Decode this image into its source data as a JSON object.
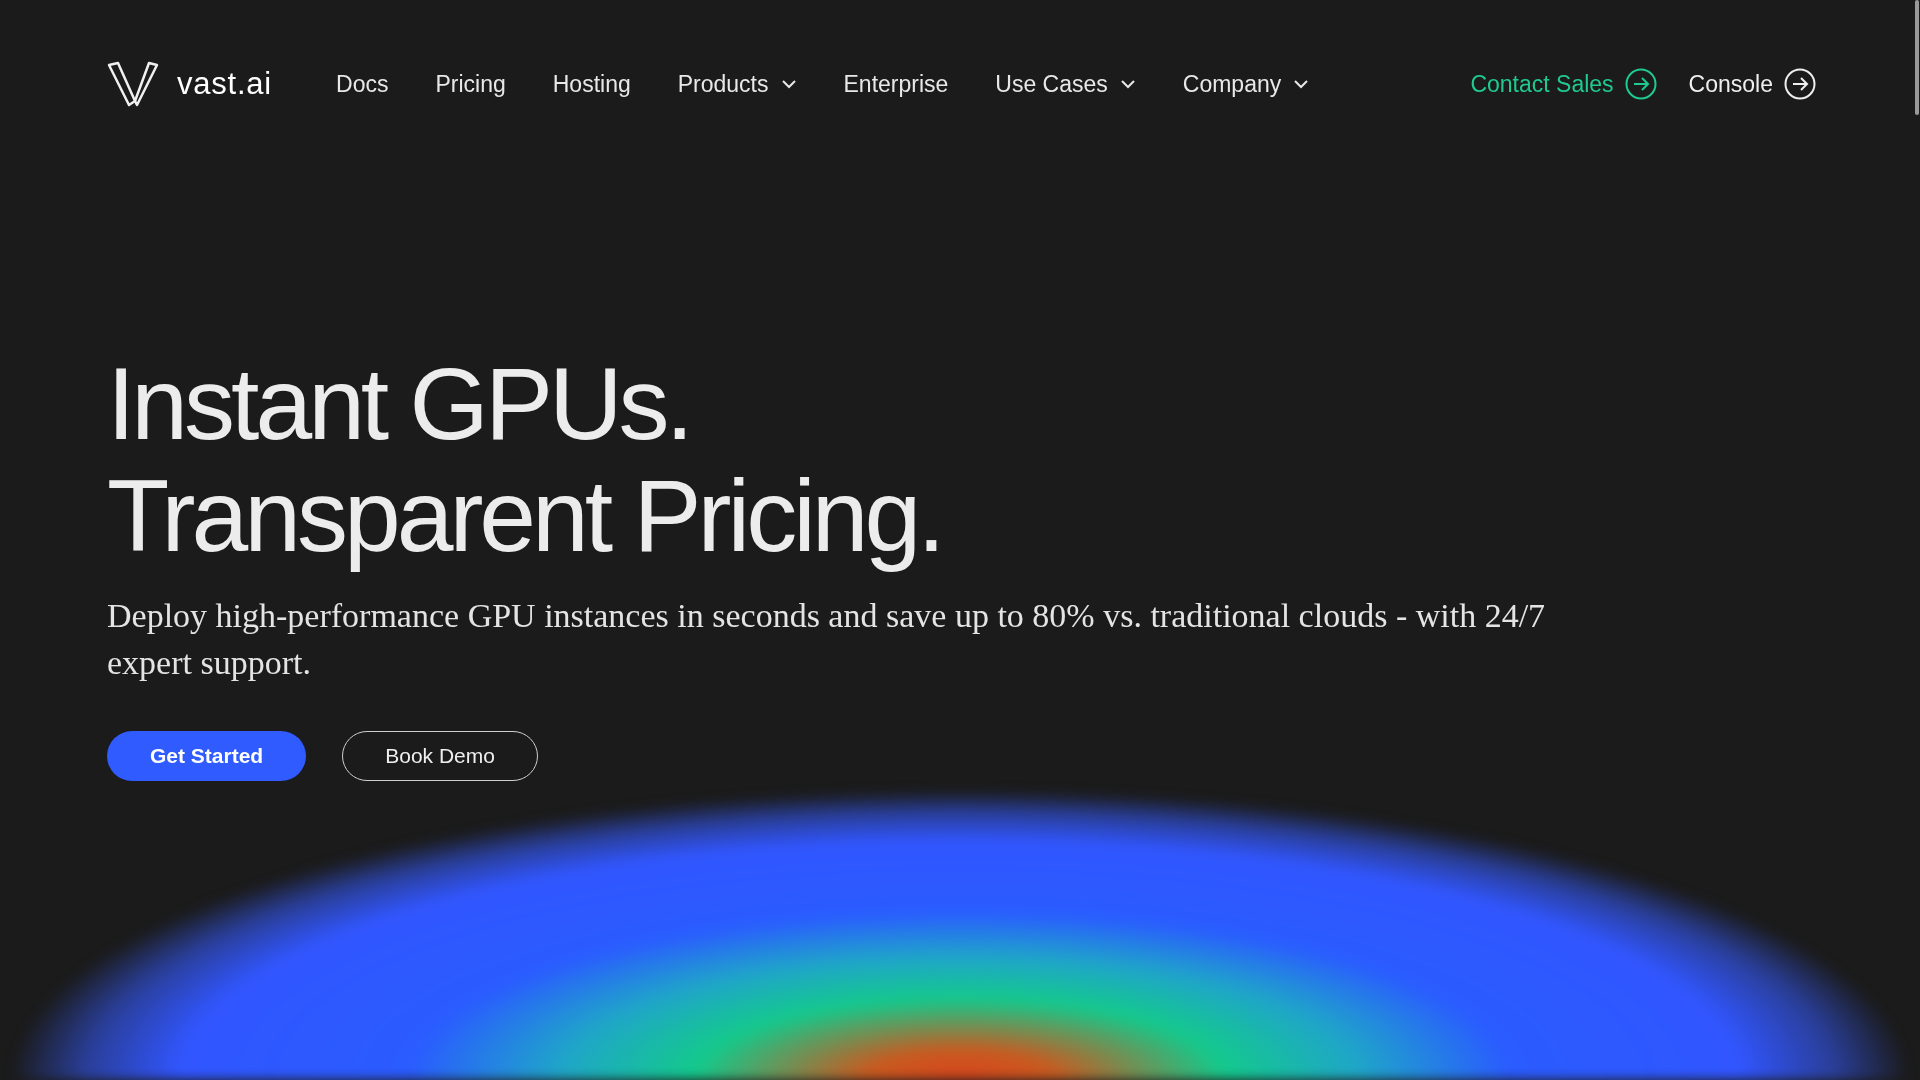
{
  "header": {
    "brand": "vast.ai",
    "nav": [
      {
        "label": "Docs",
        "dropdown": false
      },
      {
        "label": "Pricing",
        "dropdown": false
      },
      {
        "label": "Hosting",
        "dropdown": false
      },
      {
        "label": "Products",
        "dropdown": true
      },
      {
        "label": "Enterprise",
        "dropdown": false
      },
      {
        "label": "Use Cases",
        "dropdown": true
      },
      {
        "label": "Company",
        "dropdown": true
      }
    ],
    "actions": [
      {
        "label": "Contact Sales",
        "kind": "accent"
      },
      {
        "label": "Console",
        "kind": "plain"
      }
    ]
  },
  "hero": {
    "headline": [
      "Instant GPUs.",
      "Transparent Pricing."
    ],
    "subtitle": "Deploy high-performance GPU instances in seconds and save up to 80% vs. traditional clouds - with 24/7 expert support.",
    "buttons": [
      {
        "label": "Get Started",
        "kind": "primary"
      },
      {
        "label": "Book Demo",
        "kind": "outline"
      }
    ]
  }
}
